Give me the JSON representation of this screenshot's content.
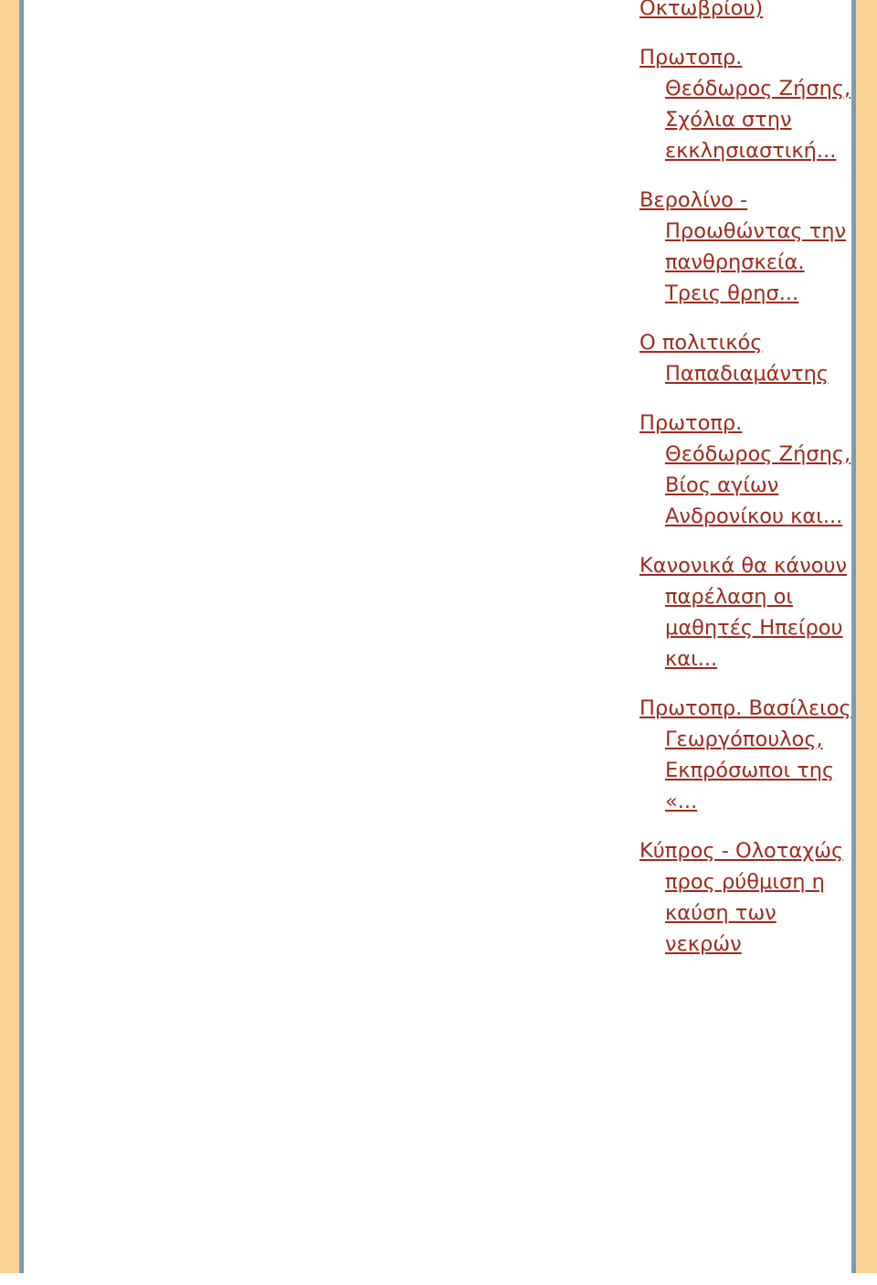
{
  "page": {
    "background_color": "#ffffff",
    "border_band_color": "#fad494",
    "border_rule_color": "#7c9bb4",
    "link_color": "#9d2b1e"
  },
  "link_list": {
    "name": "related-articles-list",
    "items": [
      {
        "text": "Οκτωβρίου)"
      },
      {
        "text": "Πρωτοπρ. Θεόδωρος Ζήσης, Σχόλια στην εκκλησιαστική..."
      },
      {
        "text": "Βερολίνο - Προωθώντας την πανθρησκεία. Τρεις θρησ..."
      },
      {
        "text": "Ο πολιτικός Παπαδιαμάντης"
      },
      {
        "text": "Πρωτοπρ. Θεόδωρος Ζήσης, Βίος αγίων Ανδρονίκου και..."
      },
      {
        "text": "Κανονικά θα κάνουν παρέλαση οι μαθητές Ηπείρου και..."
      },
      {
        "text": "Πρωτοπρ. Βασίλειος Γεωργόπουλος, Εκπρόσωποι της «..."
      },
      {
        "text": "Κύπρος - Ολοταχώς προς ρύθμιση η καύση των νεκρών"
      }
    ]
  }
}
